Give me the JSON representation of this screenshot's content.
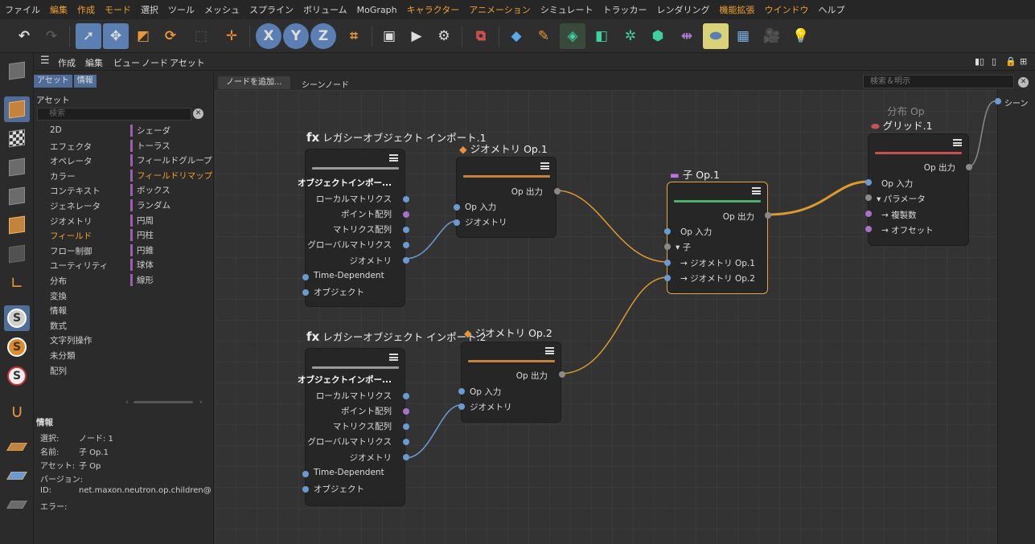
{
  "menu": [
    "ファイル",
    "編集",
    "作成",
    "モード",
    "選択",
    "ツール",
    "メッシュ",
    "スプライン",
    "ボリューム",
    "MoGraph",
    "キャラクター",
    "アニメーション",
    "シミュレート",
    "トラッカー",
    "レンダリング",
    "機能拡張",
    "ウインドウ",
    "ヘルプ"
  ],
  "menu_highlight": [
    "編集",
    "作成",
    "モード",
    "キャラクター",
    "アニメーション",
    "機能拡張",
    "ウインドウ"
  ],
  "toolbar": {
    "x": "X",
    "y": "Y",
    "z": "Z"
  },
  "panel_menu": [
    "作成",
    "編集",
    "ビュー",
    "ノード",
    "アセット"
  ],
  "asset_tabs": [
    "アセット",
    "情報"
  ],
  "asset_title": "アセット",
  "asset_search_placeholder": "検索",
  "categories": [
    "2D",
    "エフェクタ",
    "オペレータ",
    "カラー",
    "コンテキスト",
    "ジェネレータ",
    "ジオメトリ",
    "フィールド",
    "フロー制御",
    "ユーティリティ",
    "分布",
    "変換",
    "情報",
    "数式",
    "文字列操作",
    "未分類",
    "配列"
  ],
  "categories_selected": "フィールド",
  "subcategories": [
    "シェーダ",
    "トーラス",
    "フィールドグループ",
    "フィールドリマップ",
    "ボックス",
    "ランダム",
    "円周",
    "円柱",
    "円錐",
    "球体",
    "線形"
  ],
  "subcategories_selected": "フィールドリマップ",
  "info": {
    "title": "情報",
    "rows": [
      {
        "k": "選択:",
        "v": "ノード: 1"
      },
      {
        "k": "名前:",
        "v": "子 Op.1"
      },
      {
        "k": "アセット:",
        "v": "子 Op"
      },
      {
        "k": "バージョン:",
        "v": ""
      },
      {
        "k": "ID:",
        "v": "net.maxon.neutron.op.children@"
      },
      {
        "k": "エラー:",
        "v": ""
      }
    ]
  },
  "graph": {
    "add_node_button": "ノードを追加...",
    "tab": "シーンノード",
    "search_placeholder": "検索＆明示",
    "scene_port": "シーン"
  },
  "nodes": {
    "legacy1": {
      "title": "レガシーオブジェクト インポート.1",
      "ports": [
        "オブジェクトインポー...",
        "ローカルマトリクス",
        "ポイント配列",
        "マトリクス配列",
        "グローバルマトリクス",
        "ジオメトリ",
        "Time-Dependent",
        "オブジェクト"
      ]
    },
    "legacy2": {
      "title": "レガシーオブジェクト インポート.2",
      "ports": [
        "オブジェクトインポー...",
        "ローカルマトリクス",
        "ポイント配列",
        "マトリクス配列",
        "グローバルマトリクス",
        "ジオメトリ",
        "Time-Dependent",
        "オブジェクト"
      ]
    },
    "geo1": {
      "title": "ジオメトリ Op.1",
      "out": "Op 出力",
      "in": [
        "Op 入力",
        "ジオメトリ"
      ]
    },
    "geo2": {
      "title": "ジオメトリ Op.2",
      "out": "Op 出力",
      "in": [
        "Op 入力",
        "ジオメトリ"
      ]
    },
    "child": {
      "title": "子 Op.1",
      "out": "Op 出力",
      "in": [
        "Op 入力",
        "子",
        "ジオメトリ Op.1",
        "ジオメトリ Op.2"
      ]
    },
    "grid": {
      "header": "分布 Op",
      "title": "グリッド.1",
      "out": "Op 出力",
      "in": [
        "Op 入力",
        "パラメータ",
        "複製数",
        "オフセット"
      ]
    }
  },
  "colors": {
    "wire_orange": "#d99a2e",
    "wire_blue": "#6a9ad0",
    "selection": "#e0a648",
    "bar_orange": "#c4833c",
    "bar_green": "#4caf6a",
    "bar_red": "#c85050"
  }
}
